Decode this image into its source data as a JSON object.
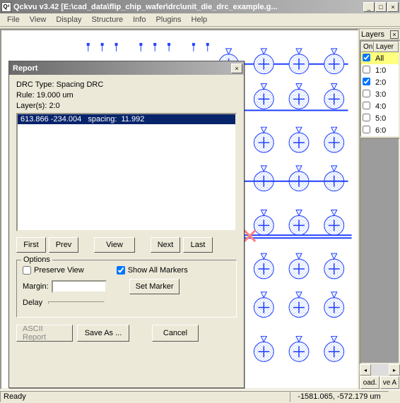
{
  "window": {
    "app_icon": "Q³",
    "title": "Qckvu v3.42 [E:\\cad_data\\flip_chip_wafer\\drc\\unit_die_drc_example.g..."
  },
  "menu": {
    "items": [
      "File",
      "View",
      "Display",
      "Structure",
      "Info",
      "Plugins",
      "Help"
    ]
  },
  "layers_panel": {
    "title": "Layers",
    "headers": {
      "on": "On",
      "layer": "Layer"
    },
    "rows": [
      {
        "checked": true,
        "label": "All",
        "all": true
      },
      {
        "checked": false,
        "label": "1:0"
      },
      {
        "checked": true,
        "label": "2:0"
      },
      {
        "checked": false,
        "label": "3:0"
      },
      {
        "checked": false,
        "label": "4:0"
      },
      {
        "checked": false,
        "label": "5:0"
      },
      {
        "checked": false,
        "label": "6:0"
      }
    ],
    "bottom_buttons": [
      "oad.",
      "ve A"
    ]
  },
  "statusbar": {
    "left": "Ready",
    "coords": "-1581.065, -572.179 um"
  },
  "report_dialog": {
    "title": "Report",
    "drc_type_label": "DRC Type: Spacing DRC",
    "rule_label": "Rule: 19.000 um",
    "layers_label": "Layer(s): 2:0",
    "list_items": [
      "613.866 -234.004   spacing:  11.992"
    ],
    "nav": {
      "first": "First",
      "prev": "Prev",
      "view": "View",
      "next": "Next",
      "last": "Last"
    },
    "options": {
      "legend": "Options",
      "preserve_view": "Preserve View",
      "show_all_markers": "Show All Markers",
      "show_all_markers_checked": true,
      "preserve_view_checked": false,
      "margin_label": "Margin:",
      "margin_value": "",
      "set_marker": "Set Marker",
      "delay_label": "Delay"
    },
    "bottom": {
      "ascii": "ASCII Report",
      "save_as": "Save As ...",
      "cancel": "Cancel"
    }
  }
}
